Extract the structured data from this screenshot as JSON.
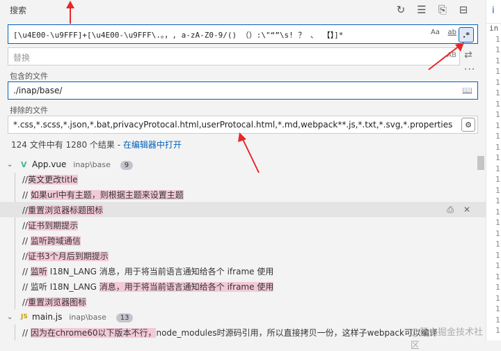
{
  "panel": {
    "title": "搜索"
  },
  "search": {
    "value": "[\\u4E00-\\u9FFF]+[\\u4E00-\\u9FFF\\.。，, a-zA-Z0-9/() （）:\\\"“”\\s! ？ 、 【】]*",
    "case_label": "Aa",
    "word_label": "ab",
    "regex_label": ".*"
  },
  "replace": {
    "placeholder": "替换",
    "preserve_case_label": "AB"
  },
  "include": {
    "label": "包含的文件",
    "value": "./inap/base/"
  },
  "exclude": {
    "label": "排除的文件",
    "value": "*.css,*.scss,*.json,*.bat,privacyProtocal.html,userProtocal.html,*.md,webpack**.js,*.txt,*.svg,*.properties"
  },
  "summary": {
    "text": "124 文件中有 1280 个结果 - ",
    "link": "在编辑器中打开"
  },
  "results": [
    {
      "file": "App.vue",
      "path": "inap\\base",
      "count": "9",
      "icon": "V",
      "icon_color": "#41b883",
      "matches": [
        {
          "pre": "//",
          "hit": "英文更改title",
          "post": ""
        },
        {
          "pre": "// ",
          "hit": "如果url中有主题，则根据主题来设置主题",
          "post": ""
        },
        {
          "pre": "//",
          "hit": "重置浏览器标题图标",
          "post": ""
        },
        {
          "pre": "//",
          "hit": "证书到期提示",
          "post": ""
        },
        {
          "pre": "// ",
          "hit": "监听跨域通信",
          "post": ""
        },
        {
          "pre": "//",
          "hit": "证书3个月后到期提示",
          "post": ""
        },
        {
          "pre": "// ",
          "hit": "监听",
          "post": " I18N_LANG 消息，用于将当前语言通知给各个 iframe 使用"
        },
        {
          "pre": "// 监听 I18N_LANG ",
          "hit": "消息，用于将当前语言通知给各个 iframe 使用",
          "post": ""
        },
        {
          "pre": "//",
          "hit": "重置浏览器图标",
          "post": ""
        }
      ]
    },
    {
      "file": "main.js",
      "path": "inap\\base",
      "count": "13",
      "icon": "JS",
      "icon_color": "#c9a000",
      "matches": [
        {
          "pre": "// ",
          "hit": "因为在chrome60以下版本不行，",
          "post": "node_modules时源码引用，所以直接拷贝一份，这样子webpack可以编译"
        }
      ]
    }
  ],
  "watermark": "@稀土掘金技术社区",
  "editor_strip": {
    "tab": "i",
    "file_prefix": "in",
    "line_digit": "1"
  }
}
